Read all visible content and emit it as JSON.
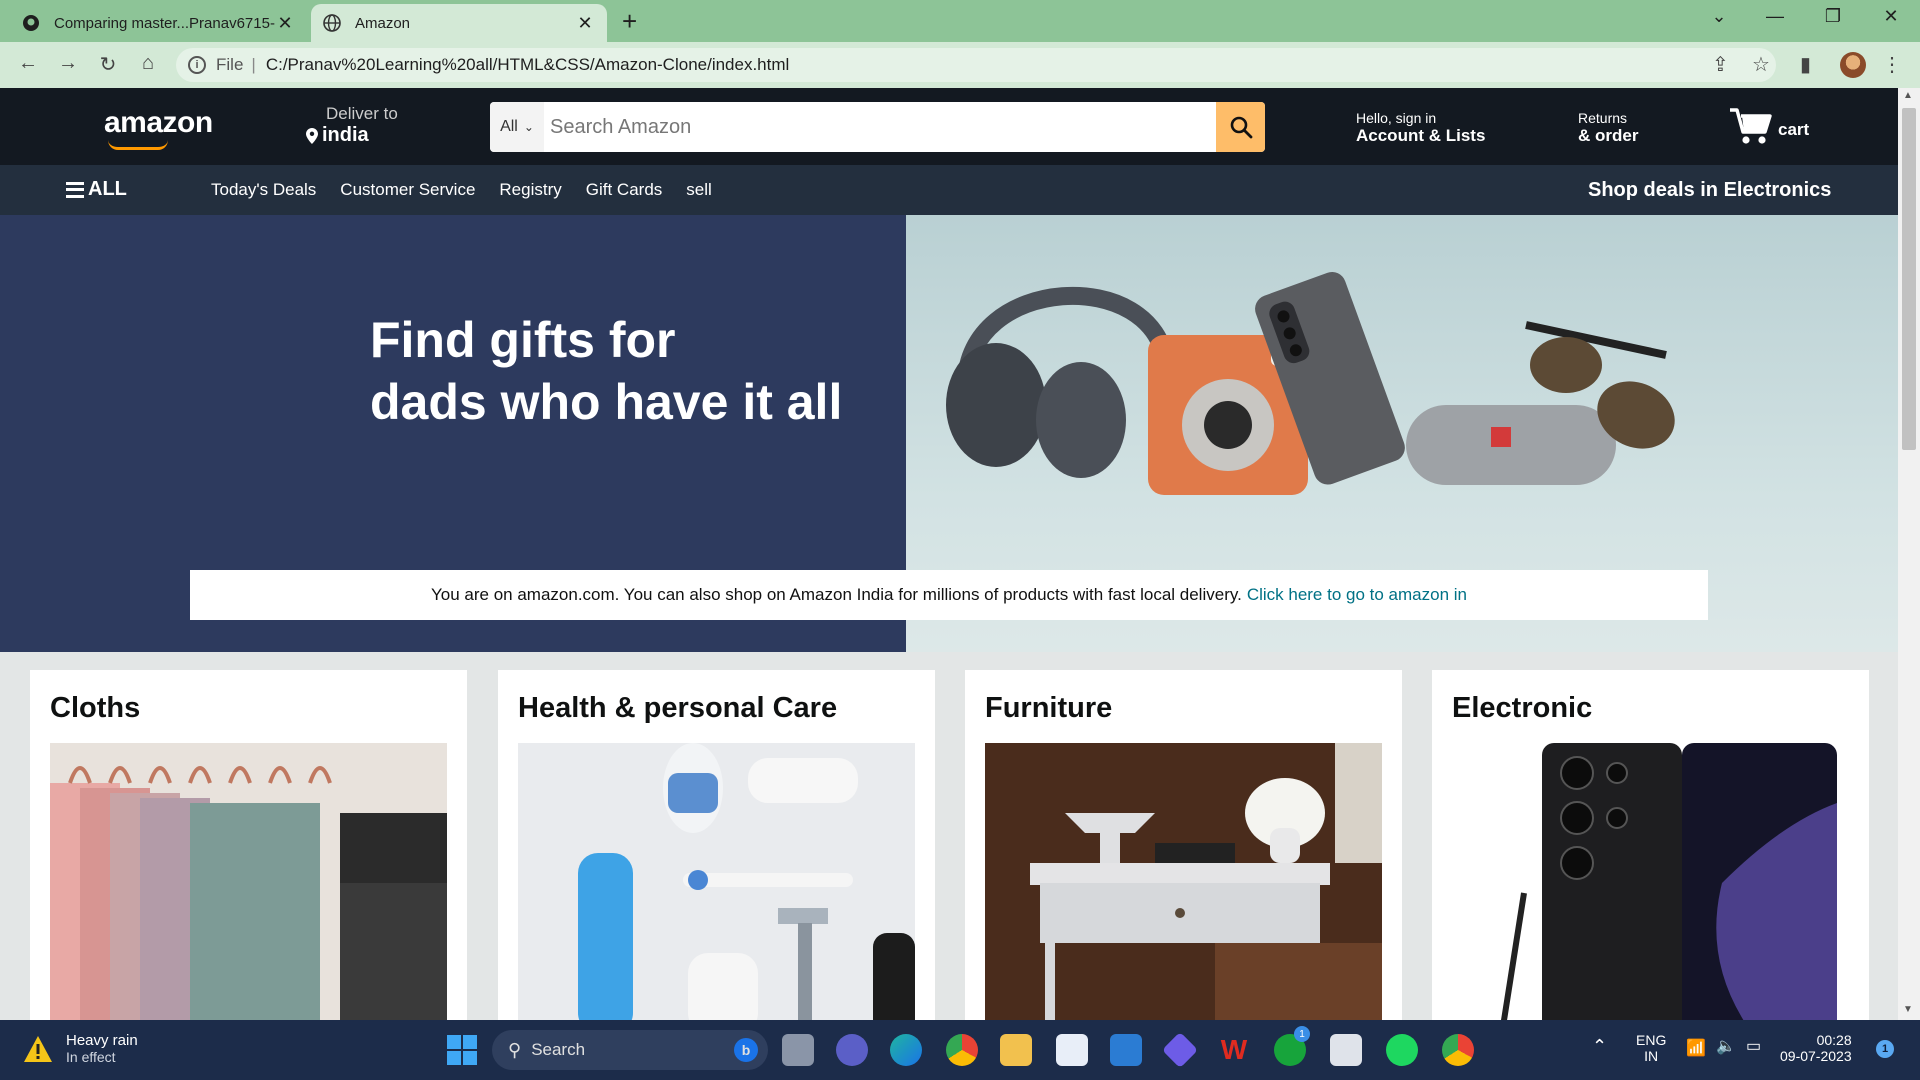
{
  "browser": {
    "tabs": [
      {
        "title": "Comparing master...Pranav6715-",
        "icon": "github-icon",
        "active": false
      },
      {
        "title": "Amazon",
        "icon": "globe-icon",
        "active": true
      }
    ],
    "address": {
      "scheme_label": "File",
      "url": "C:/Pranav%20Learning%20all/HTML&CSS/Amazon-Clone/index.html"
    }
  },
  "navbar": {
    "logo": "amazon",
    "deliver_label": "Deliver to",
    "deliver_location": "india",
    "search_category": "All",
    "search_placeholder": "Search Amazon",
    "account_line1": "Hello, sign in",
    "account_line2": "Account & Lists",
    "returns_line1": "Returns",
    "returns_line2": "& order",
    "cart_label": "cart"
  },
  "subnav": {
    "all_label": "ALL",
    "links": [
      "Today's Deals",
      "Customer Service",
      "Registry",
      "Gift Cards",
      "sell"
    ],
    "promo": "Shop deals in Electronics"
  },
  "hero": {
    "title_line1": "Find gifts for",
    "title_line2": "dads who have it all",
    "notice_text": "You are on amazon.com. You can also shop on Amazon India for millions of products with fast local delivery.",
    "notice_link": "Click here to go to amazon in"
  },
  "cards": [
    {
      "title": "Cloths"
    },
    {
      "title": "Health & personal Care"
    },
    {
      "title": "Furniture"
    },
    {
      "title": "Electronic"
    }
  ],
  "taskbar": {
    "weather_title": "Heavy rain",
    "weather_sub": "In effect",
    "search_label": "Search",
    "lang_line1": "ENG",
    "lang_line2": "IN",
    "time": "00:28",
    "date": "09-07-2023",
    "notif_count": "1",
    "xbox_badge": "1"
  },
  "colors": {
    "amazon_nav": "#131921",
    "amazon_subnav": "#232f3e",
    "search_button": "#febd69",
    "hero_left": "#2d3a5e",
    "link": "#007185",
    "browser_frame": "#8dc497"
  }
}
